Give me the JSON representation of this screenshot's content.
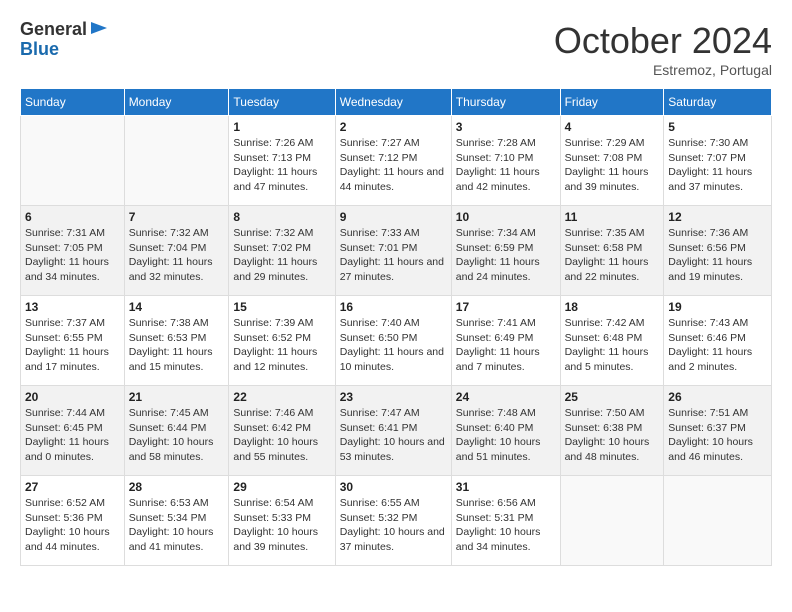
{
  "logo": {
    "general": "General",
    "blue": "Blue"
  },
  "header": {
    "month": "October 2024",
    "location": "Estremoz, Portugal"
  },
  "weekdays": [
    "Sunday",
    "Monday",
    "Tuesday",
    "Wednesday",
    "Thursday",
    "Friday",
    "Saturday"
  ],
  "weeks": [
    [
      {
        "day": "",
        "sunrise": "",
        "sunset": "",
        "daylight": ""
      },
      {
        "day": "",
        "sunrise": "",
        "sunset": "",
        "daylight": ""
      },
      {
        "day": "1",
        "sunrise": "Sunrise: 7:26 AM",
        "sunset": "Sunset: 7:13 PM",
        "daylight": "Daylight: 11 hours and 47 minutes."
      },
      {
        "day": "2",
        "sunrise": "Sunrise: 7:27 AM",
        "sunset": "Sunset: 7:12 PM",
        "daylight": "Daylight: 11 hours and 44 minutes."
      },
      {
        "day": "3",
        "sunrise": "Sunrise: 7:28 AM",
        "sunset": "Sunset: 7:10 PM",
        "daylight": "Daylight: 11 hours and 42 minutes."
      },
      {
        "day": "4",
        "sunrise": "Sunrise: 7:29 AM",
        "sunset": "Sunset: 7:08 PM",
        "daylight": "Daylight: 11 hours and 39 minutes."
      },
      {
        "day": "5",
        "sunrise": "Sunrise: 7:30 AM",
        "sunset": "Sunset: 7:07 PM",
        "daylight": "Daylight: 11 hours and 37 minutes."
      }
    ],
    [
      {
        "day": "6",
        "sunrise": "Sunrise: 7:31 AM",
        "sunset": "Sunset: 7:05 PM",
        "daylight": "Daylight: 11 hours and 34 minutes."
      },
      {
        "day": "7",
        "sunrise": "Sunrise: 7:32 AM",
        "sunset": "Sunset: 7:04 PM",
        "daylight": "Daylight: 11 hours and 32 minutes."
      },
      {
        "day": "8",
        "sunrise": "Sunrise: 7:32 AM",
        "sunset": "Sunset: 7:02 PM",
        "daylight": "Daylight: 11 hours and 29 minutes."
      },
      {
        "day": "9",
        "sunrise": "Sunrise: 7:33 AM",
        "sunset": "Sunset: 7:01 PM",
        "daylight": "Daylight: 11 hours and 27 minutes."
      },
      {
        "day": "10",
        "sunrise": "Sunrise: 7:34 AM",
        "sunset": "Sunset: 6:59 PM",
        "daylight": "Daylight: 11 hours and 24 minutes."
      },
      {
        "day": "11",
        "sunrise": "Sunrise: 7:35 AM",
        "sunset": "Sunset: 6:58 PM",
        "daylight": "Daylight: 11 hours and 22 minutes."
      },
      {
        "day": "12",
        "sunrise": "Sunrise: 7:36 AM",
        "sunset": "Sunset: 6:56 PM",
        "daylight": "Daylight: 11 hours and 19 minutes."
      }
    ],
    [
      {
        "day": "13",
        "sunrise": "Sunrise: 7:37 AM",
        "sunset": "Sunset: 6:55 PM",
        "daylight": "Daylight: 11 hours and 17 minutes."
      },
      {
        "day": "14",
        "sunrise": "Sunrise: 7:38 AM",
        "sunset": "Sunset: 6:53 PM",
        "daylight": "Daylight: 11 hours and 15 minutes."
      },
      {
        "day": "15",
        "sunrise": "Sunrise: 7:39 AM",
        "sunset": "Sunset: 6:52 PM",
        "daylight": "Daylight: 11 hours and 12 minutes."
      },
      {
        "day": "16",
        "sunrise": "Sunrise: 7:40 AM",
        "sunset": "Sunset: 6:50 PM",
        "daylight": "Daylight: 11 hours and 10 minutes."
      },
      {
        "day": "17",
        "sunrise": "Sunrise: 7:41 AM",
        "sunset": "Sunset: 6:49 PM",
        "daylight": "Daylight: 11 hours and 7 minutes."
      },
      {
        "day": "18",
        "sunrise": "Sunrise: 7:42 AM",
        "sunset": "Sunset: 6:48 PM",
        "daylight": "Daylight: 11 hours and 5 minutes."
      },
      {
        "day": "19",
        "sunrise": "Sunrise: 7:43 AM",
        "sunset": "Sunset: 6:46 PM",
        "daylight": "Daylight: 11 hours and 2 minutes."
      }
    ],
    [
      {
        "day": "20",
        "sunrise": "Sunrise: 7:44 AM",
        "sunset": "Sunset: 6:45 PM",
        "daylight": "Daylight: 11 hours and 0 minutes."
      },
      {
        "day": "21",
        "sunrise": "Sunrise: 7:45 AM",
        "sunset": "Sunset: 6:44 PM",
        "daylight": "Daylight: 10 hours and 58 minutes."
      },
      {
        "day": "22",
        "sunrise": "Sunrise: 7:46 AM",
        "sunset": "Sunset: 6:42 PM",
        "daylight": "Daylight: 10 hours and 55 minutes."
      },
      {
        "day": "23",
        "sunrise": "Sunrise: 7:47 AM",
        "sunset": "Sunset: 6:41 PM",
        "daylight": "Daylight: 10 hours and 53 minutes."
      },
      {
        "day": "24",
        "sunrise": "Sunrise: 7:48 AM",
        "sunset": "Sunset: 6:40 PM",
        "daylight": "Daylight: 10 hours and 51 minutes."
      },
      {
        "day": "25",
        "sunrise": "Sunrise: 7:50 AM",
        "sunset": "Sunset: 6:38 PM",
        "daylight": "Daylight: 10 hours and 48 minutes."
      },
      {
        "day": "26",
        "sunrise": "Sunrise: 7:51 AM",
        "sunset": "Sunset: 6:37 PM",
        "daylight": "Daylight: 10 hours and 46 minutes."
      }
    ],
    [
      {
        "day": "27",
        "sunrise": "Sunrise: 6:52 AM",
        "sunset": "Sunset: 5:36 PM",
        "daylight": "Daylight: 10 hours and 44 minutes."
      },
      {
        "day": "28",
        "sunrise": "Sunrise: 6:53 AM",
        "sunset": "Sunset: 5:34 PM",
        "daylight": "Daylight: 10 hours and 41 minutes."
      },
      {
        "day": "29",
        "sunrise": "Sunrise: 6:54 AM",
        "sunset": "Sunset: 5:33 PM",
        "daylight": "Daylight: 10 hours and 39 minutes."
      },
      {
        "day": "30",
        "sunrise": "Sunrise: 6:55 AM",
        "sunset": "Sunset: 5:32 PM",
        "daylight": "Daylight: 10 hours and 37 minutes."
      },
      {
        "day": "31",
        "sunrise": "Sunrise: 6:56 AM",
        "sunset": "Sunset: 5:31 PM",
        "daylight": "Daylight: 10 hours and 34 minutes."
      },
      {
        "day": "",
        "sunrise": "",
        "sunset": "",
        "daylight": ""
      },
      {
        "day": "",
        "sunrise": "",
        "sunset": "",
        "daylight": ""
      }
    ]
  ]
}
